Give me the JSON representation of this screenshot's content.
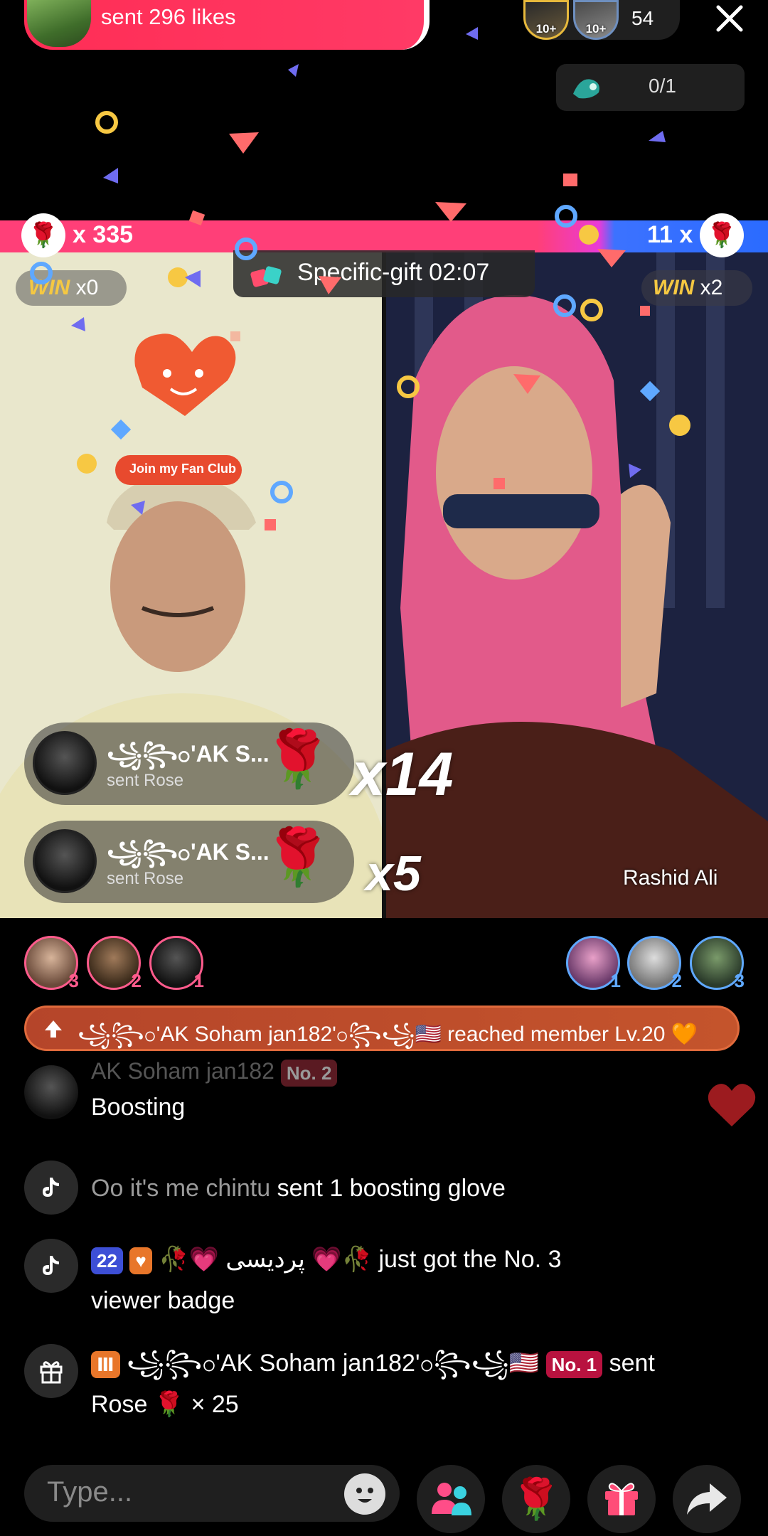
{
  "top": {
    "likes_text": "sent 296 likes",
    "viewer_badge_1": "10+",
    "viewer_badge_2": "10+",
    "viewer_count": "54",
    "goal_text": "0/1"
  },
  "battle": {
    "left_score": "x 335",
    "right_score": "11 x",
    "left_win_label": "WIN",
    "left_win_count": "x0",
    "right_win_label": "WIN",
    "right_win_count": "x2",
    "specific_gift": "Specific-gift 02:07",
    "right_host_name": "Rashid Ali",
    "fan_club_label": "Join my Fan Club"
  },
  "gifts": [
    {
      "name": "꧁꧂၀ʹAK S...",
      "sub": "sent Rose",
      "multiplier": "x14"
    },
    {
      "name": "꧁꧂၀ʹAK S...",
      "sub": "sent Rose",
      "multiplier": "x5"
    }
  ],
  "supporters_left": [
    "3",
    "2",
    "1"
  ],
  "supporters_right": [
    "1",
    "2",
    "3"
  ],
  "banner": {
    "text": "꧁꧂၀ʹAK Soham jan182ʹ၀꧂꧁🇺🇸 reached member Lv.20 🧡"
  },
  "chat": {
    "faded_line": "AK Soham jan182",
    "faded_badge": "No. 2",
    "msg1": "Boosting",
    "msg2_user": "Oo it's me chintu",
    "msg2_text": "sent 1 boosting glove",
    "msg3_badge": "22",
    "msg3_user": "🥀💗 پردیسی 💗🥀",
    "msg3_text": "just got the No. 3",
    "msg3_text2": "viewer badge",
    "msg4_user": "꧁꧂၀ʹAK Soham jan182ʹ၀꧂꧁🇺🇸",
    "msg4_badge": "No. 1",
    "msg4_text": "sent",
    "msg4_text2": "Rose 🌹 × 25"
  },
  "input": {
    "placeholder": "Type..."
  },
  "colors": {
    "likes_pill": "#ff2d55",
    "battle_left": "#ff3f78",
    "battle_right": "#2b6bff",
    "banner": "#c4542c"
  },
  "icons": [
    "close-icon",
    "gift-icon",
    "rose-icon",
    "tiktok-icon",
    "emoji-icon",
    "multi-guest-icon",
    "share-icon",
    "heart-icon",
    "arrow-up-icon"
  ]
}
